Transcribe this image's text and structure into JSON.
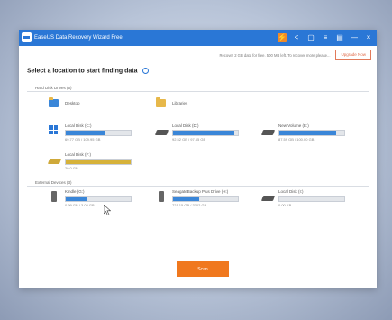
{
  "window": {
    "title": "EaseUS Data Recovery Wizard Free",
    "toolbar_icons": [
      "fire-icon",
      "share-icon",
      "user-icon",
      "menu-icon",
      "minimize-icon",
      "maximize-icon",
      "close-icon"
    ]
  },
  "promo": {
    "text": "Recover 2 GB data for free. 500 MB left. To recover more please...",
    "upgrade_label": "Upgrade Now"
  },
  "heading": "Select a location to start finding data",
  "sections": {
    "hdd": "Hard Disk Drives (5)",
    "external": "External Devices (3)"
  },
  "folders": {
    "desktop": "Desktop",
    "libraries": "Libraries"
  },
  "drives": [
    {
      "name": "Local Disk (C:)",
      "size": "69.77 GB / 109.95 GB",
      "fill": 0.6
    },
    {
      "name": "Local Disk (D:)",
      "size": "92.52 GB / 97.65 GB",
      "fill": 0.95
    },
    {
      "name": "New Volume (E:)",
      "size": "87.59 GB / 100.00 GB",
      "fill": 0.88
    },
    {
      "name": "Local Disk (F:)",
      "size": "20.0 GB",
      "fill": 1.0
    }
  ],
  "external": [
    {
      "name": "Kindle (G:)",
      "size": "0.99 GB / 3.05 GB",
      "fill": 0.32
    },
    {
      "name": "SeagateBackup Plus Drive (H:)",
      "size": "721.15 GB / 3702 GB",
      "fill": 0.4
    },
    {
      "name": "Local Disk (I:)",
      "size": "0.00 KB",
      "fill": 0.0
    }
  ],
  "scan_label": "Scan"
}
